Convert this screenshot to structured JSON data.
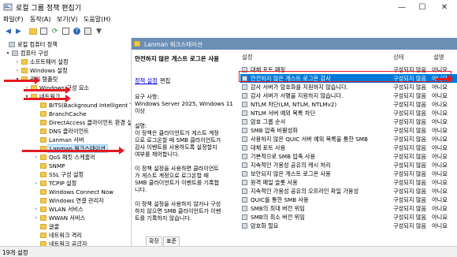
{
  "window": {
    "title": "로컬 그룹 정책 편집기",
    "controls": {
      "minimize": "—",
      "maximize": "☐",
      "close": "✕"
    }
  },
  "menu": [
    "파일(F)",
    "동작(A)",
    "보기(V)",
    "도움말(H)"
  ],
  "toolbar_icons": [
    "back-icon",
    "forward-icon",
    "folder-icon",
    "show-hide-tree-icon",
    "refresh-icon",
    "export-list-icon",
    "help-icon",
    "properties-icon",
    "filter-icon"
  ],
  "tree": [
    {
      "label": "로컬 컴퓨터 정책",
      "arrow": "",
      "icon": "policy"
    },
    {
      "label": "컴퓨터 구성",
      "arrow": "▾",
      "icon": "computer"
    },
    {
      "label": "소프트웨어 설정",
      "arrow": "›",
      "icon": "folder"
    },
    {
      "label": "Windows 설정",
      "arrow": "›",
      "icon": "folder"
    },
    {
      "label": "관리 템플릿",
      "arrow": "▾",
      "icon": "folder"
    },
    {
      "label": "Windows 구성 요소",
      "arrow": "›",
      "icon": "folder"
    },
    {
      "label": "네트워크",
      "arrow": "▾",
      "icon": "folder"
    },
    {
      "label": "BITS(Background Intelligent Transf",
      "arrow": "",
      "icon": "folder"
    },
    {
      "label": "BranchCache",
      "arrow": "",
      "icon": "folder"
    },
    {
      "label": "DirectAccess 클라이언트 환경 설정",
      "arrow": "",
      "icon": "folder"
    },
    {
      "label": "DNS 클라이언트",
      "arrow": "",
      "icon": "folder"
    },
    {
      "label": "Lanman 서버",
      "arrow": "",
      "icon": "folder"
    },
    {
      "label": "Lanman 워크스테이션",
      "arrow": "",
      "icon": "folder",
      "selected": true
    },
    {
      "label": "QoS 패킷 스케줄러",
      "arrow": "›",
      "icon": "folder"
    },
    {
      "label": "SNMP",
      "arrow": "",
      "icon": "folder"
    },
    {
      "label": "SSL 구성 설정",
      "arrow": "",
      "icon": "folder"
    },
    {
      "label": "TCPIP 설정",
      "arrow": "›",
      "icon": "folder"
    },
    {
      "label": "Windows Connect Now",
      "arrow": "",
      "icon": "folder"
    },
    {
      "label": "Windows 연결 관리자",
      "arrow": "",
      "icon": "folder"
    },
    {
      "label": "WLAN 서비스",
      "arrow": "›",
      "icon": "folder"
    },
    {
      "label": "WWAN 서비스",
      "arrow": "›",
      "icon": "folder"
    },
    {
      "label": "글꼴",
      "arrow": "",
      "icon": "folder"
    },
    {
      "label": "네트워크 격리",
      "arrow": "",
      "icon": "folder"
    },
    {
      "label": "네트워크 공급자",
      "arrow": "",
      "icon": "folder"
    }
  ],
  "right_header": "Lanman 워크스테이션",
  "description": {
    "heading": "안전하지 않은 게스트 로그온 사용",
    "link_text": "정책 설정",
    "link_suffix": " 편집",
    "requirement": "요구 사항:\nWindows Server 2025, Windows 11\n이상",
    "body": "설명:\n이 정책은 클라이언트가 게스트 계정\n으로 로그온할 때 SMB 클라이언트가\n감사 이벤트를 사용하도록 설정할지\n여부를 제어합니다.\n\n이 정책 설정을 사용하면 클라이언트\n가 게스트 계정으로 로그온할 때\nSMB 클라이언트가 이벤트를 기록합\n니다.\n\n이 정책 설정을 사용하지 않거나 구성\n하지 않으면 SMB 클라이언트가 이벤\n트를 기록하지 않습니다."
  },
  "list_columns": {
    "name": "설정",
    "state": "상태",
    "comment": "설명"
  },
  "list_rows": [
    {
      "name": "대체 포트 매핑",
      "state": "구성되지 않음",
      "comment": "아니요"
    },
    {
      "name": "안전하지 않은 게스트 로그온 감사",
      "state": "구성되지 않음",
      "comment": "아니요",
      "selected": true
    },
    {
      "name": "감사 서버가 암호화를 지원하지 않습니다.",
      "state": "구성되지 않음",
      "comment": "아니요"
    },
    {
      "name": "감사 서버가 서명을 지원하지 않습니다.",
      "state": "구성되지 않음",
      "comment": "아니요"
    },
    {
      "name": "NTLM 차단(LM, NTLM, NTLMv2)",
      "state": "구성되지 않음",
      "comment": "아니요"
    },
    {
      "name": "NTLM 서버 예외 목록 차단",
      "state": "구성되지 않음",
      "comment": "아니요"
    },
    {
      "name": "암호 그룹 순서",
      "state": "구성되지 않음",
      "comment": "아니요"
    },
    {
      "name": "SMB 압축 비활성화",
      "state": "구성되지 않음",
      "comment": "아니요"
    },
    {
      "name": "사용하지 않은 QUIC 서버 예외 목록을 통한 SMB",
      "state": "구성되지 않음",
      "comment": "아니요"
    },
    {
      "name": "대체 포트 사용",
      "state": "구성되지 않음",
      "comment": "아니요"
    },
    {
      "name": "기본적으로 SMB 압축 사용",
      "state": "구성되지 않음",
      "comment": "아니요"
    },
    {
      "name": "지속적인 가용성 공유의 캐시 처리",
      "state": "구성되지 않음",
      "comment": "아니요"
    },
    {
      "name": "보안되지 않은 게스트 로그온 사용",
      "state": "구성되지 않음",
      "comment": "아니요"
    },
    {
      "name": "원격 메일 슬롯 사용",
      "state": "구성되지 않음",
      "comment": "아니요"
    },
    {
      "name": "지속적인 가용성 공유의 오프라인 파일 가용성",
      "state": "구성되지 않음",
      "comment": "아니요"
    },
    {
      "name": "QUIC를 통한 SMB 사용",
      "state": "구성되지 않음",
      "comment": "아니요"
    },
    {
      "name": "SMB의 최대 버전 위임",
      "state": "구성되지 않음",
      "comment": "아니요"
    },
    {
      "name": "SMB의 최소 버전 위임",
      "state": "구성되지 않음",
      "comment": "아니요"
    },
    {
      "name": "암호화 필요",
      "state": "구성되지 않음",
      "comment": "아니요"
    }
  ],
  "tabs": [
    "확장",
    "표준"
  ],
  "status": "19개 설정",
  "colors": {
    "selection": "#0078d7",
    "header": "#6b8fb5",
    "annotation": "#e31b23"
  }
}
